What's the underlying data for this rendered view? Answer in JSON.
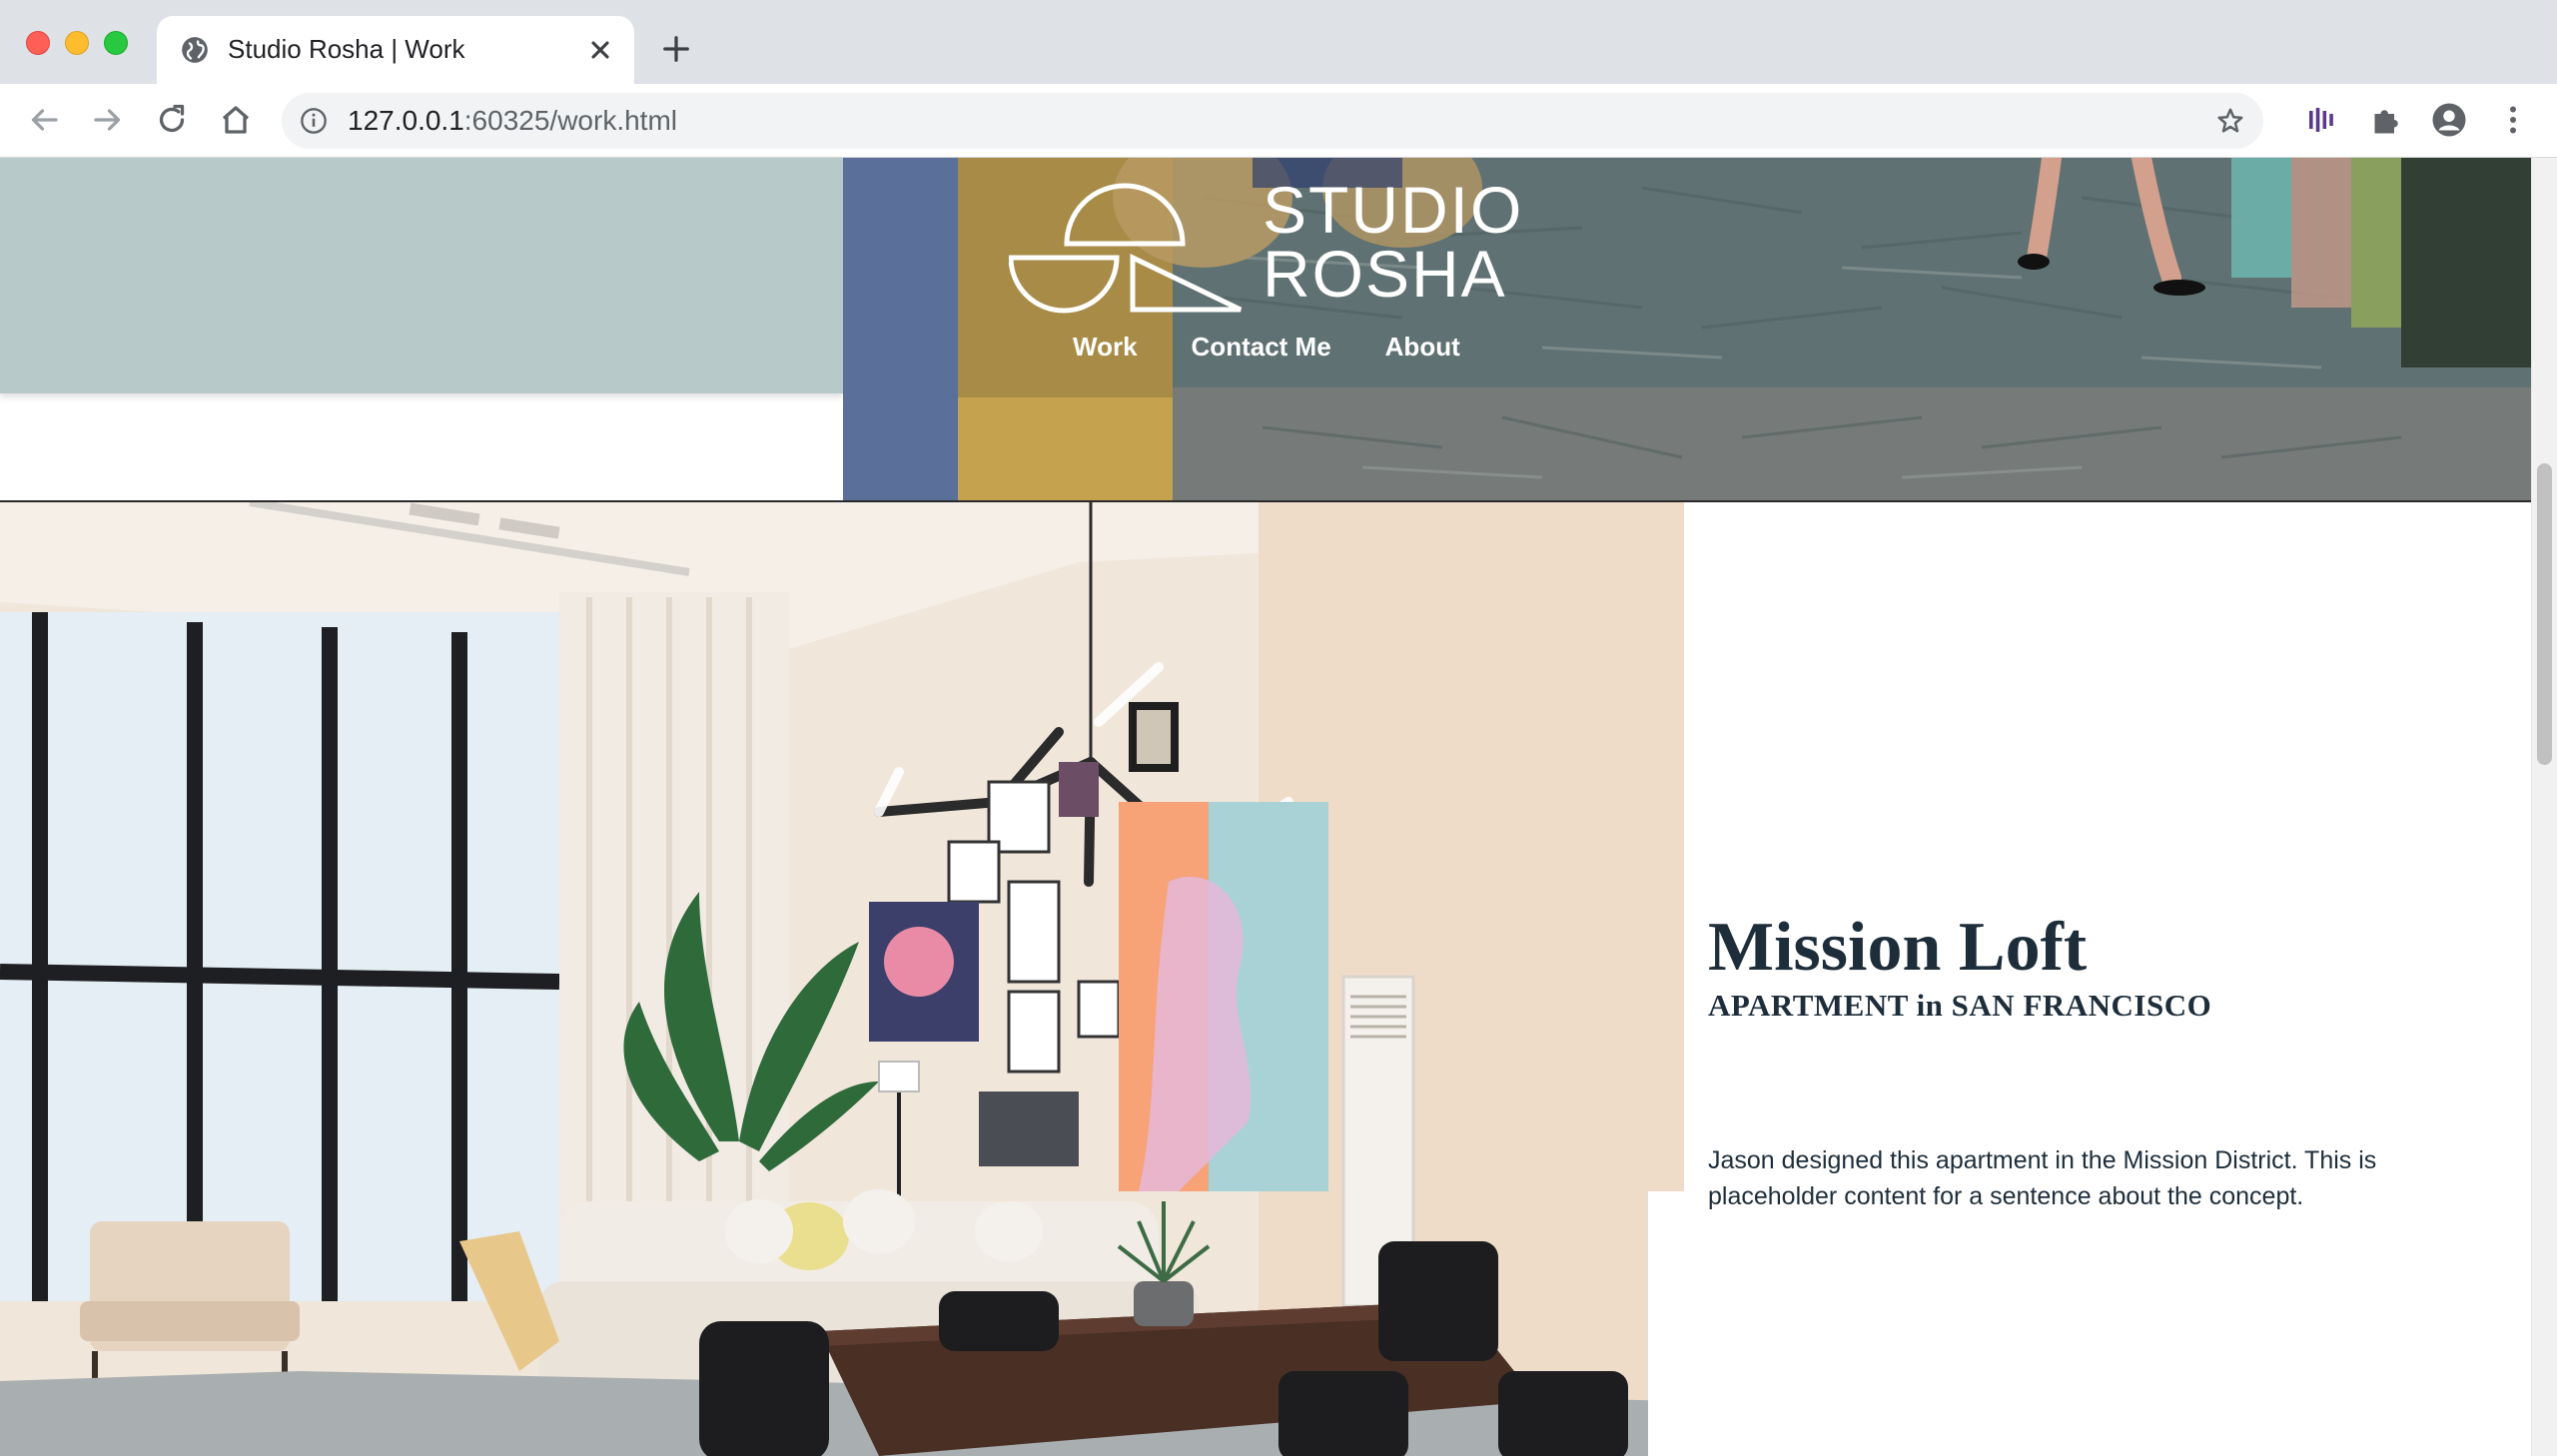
{
  "browser": {
    "tab_title": "Studio Rosha | Work",
    "url_host": "127.0.0.1",
    "url_rest": ":60325/work.html"
  },
  "site": {
    "logo": {
      "line1": "STUDIO",
      "line2": "ROSHA"
    },
    "nav": [
      {
        "label": "Work"
      },
      {
        "label": "Contact Me"
      },
      {
        "label": "About"
      }
    ]
  },
  "project": {
    "title": "Mission Loft",
    "subtitle": "APARTMENT in SAN FRANCISCO",
    "description": "Jason designed this apartment in the Mission District. This is placeholder content for a sentence about the concept."
  },
  "colors": {
    "band": "#b8c9c9",
    "text_dark": "#1d2d3a",
    "nav_text": "#ffffff"
  }
}
